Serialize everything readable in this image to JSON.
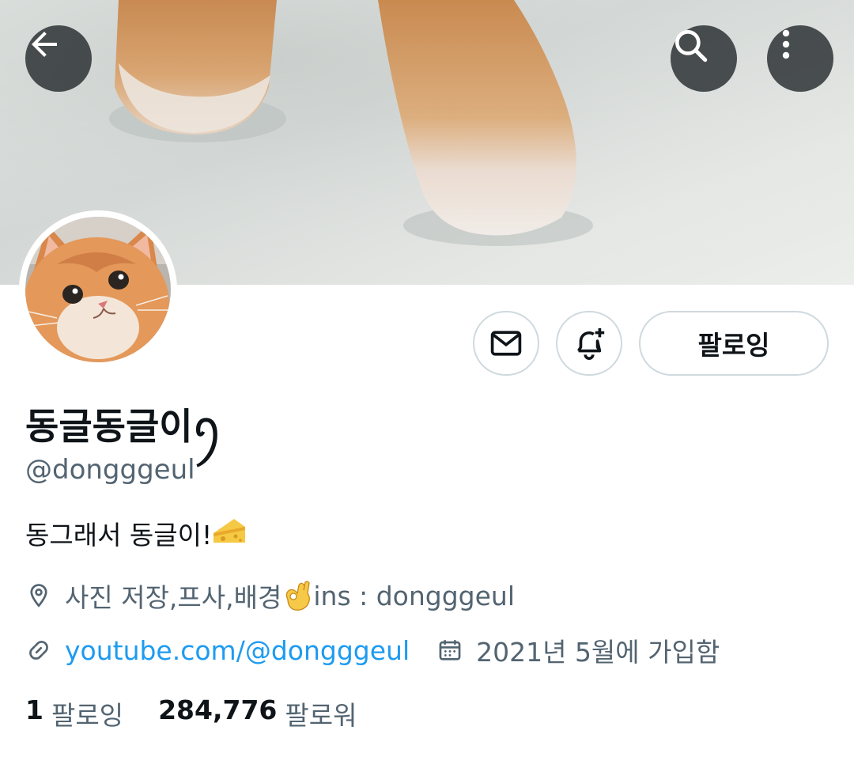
{
  "header": {
    "back_icon": "arrow-left-icon",
    "search_icon": "search-icon",
    "more_icon": "more-vertical-icon"
  },
  "profile": {
    "display_name": "동글동글이ꪆ",
    "handle": "@dongggeul",
    "bio": "동그래서 동글이!",
    "bio_emoji": "cheese-emoji",
    "location": "사진 저장,프사,배경",
    "location_emoji": "ok-hand-emoji",
    "location_suffix": " ins : dongggeul",
    "website": "youtube.com/@dongggeul",
    "joined": "2021년 5월에 가입함"
  },
  "actions": {
    "message_icon": "mail-icon",
    "notify_icon": "bell-plus-icon",
    "follow_label": "팔로잉"
  },
  "stats": {
    "following_count": "1",
    "following_label": "팔로잉",
    "followers_count": "284,776",
    "followers_label": "팔로워"
  },
  "colors": {
    "accent": "#1d9bf0",
    "text_primary": "#0f1419",
    "text_secondary": "#536471",
    "border": "#cfd9de"
  }
}
